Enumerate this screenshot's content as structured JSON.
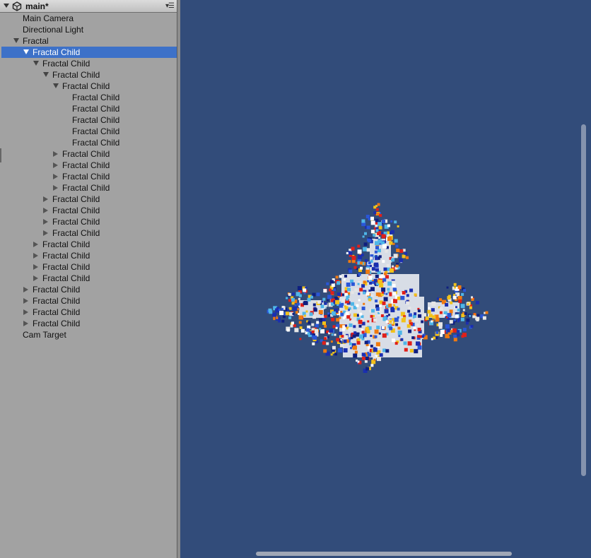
{
  "hierarchy": {
    "scene_name": "main*",
    "items": [
      {
        "label": "Main Camera",
        "depth": 0,
        "arrow": "none",
        "selected": false
      },
      {
        "label": "Directional Light",
        "depth": 0,
        "arrow": "none",
        "selected": false
      },
      {
        "label": "Fractal",
        "depth": 0,
        "arrow": "down",
        "selected": false
      },
      {
        "label": "Fractal Child",
        "depth": 1,
        "arrow": "down",
        "selected": true
      },
      {
        "label": "Fractal Child",
        "depth": 2,
        "arrow": "down",
        "selected": false
      },
      {
        "label": "Fractal Child",
        "depth": 3,
        "arrow": "down",
        "selected": false
      },
      {
        "label": "Fractal Child",
        "depth": 4,
        "arrow": "down",
        "selected": false
      },
      {
        "label": "Fractal Child",
        "depth": 5,
        "arrow": "none",
        "selected": false
      },
      {
        "label": "Fractal Child",
        "depth": 5,
        "arrow": "none",
        "selected": false
      },
      {
        "label": "Fractal Child",
        "depth": 5,
        "arrow": "none",
        "selected": false
      },
      {
        "label": "Fractal Child",
        "depth": 5,
        "arrow": "none",
        "selected": false
      },
      {
        "label": "Fractal Child",
        "depth": 5,
        "arrow": "none",
        "selected": false
      },
      {
        "label": "Fractal Child",
        "depth": 4,
        "arrow": "right",
        "selected": false
      },
      {
        "label": "Fractal Child",
        "depth": 4,
        "arrow": "right",
        "selected": false
      },
      {
        "label": "Fractal Child",
        "depth": 4,
        "arrow": "right",
        "selected": false
      },
      {
        "label": "Fractal Child",
        "depth": 4,
        "arrow": "right",
        "selected": false
      },
      {
        "label": "Fractal Child",
        "depth": 3,
        "arrow": "right",
        "selected": false
      },
      {
        "label": "Fractal Child",
        "depth": 3,
        "arrow": "right",
        "selected": false
      },
      {
        "label": "Fractal Child",
        "depth": 3,
        "arrow": "right",
        "selected": false
      },
      {
        "label": "Fractal Child",
        "depth": 3,
        "arrow": "right",
        "selected": false
      },
      {
        "label": "Fractal Child",
        "depth": 2,
        "arrow": "right",
        "selected": false
      },
      {
        "label": "Fractal Child",
        "depth": 2,
        "arrow": "right",
        "selected": false
      },
      {
        "label": "Fractal Child",
        "depth": 2,
        "arrow": "right",
        "selected": false
      },
      {
        "label": "Fractal Child",
        "depth": 2,
        "arrow": "right",
        "selected": false
      },
      {
        "label": "Fractal Child",
        "depth": 1,
        "arrow": "right",
        "selected": false
      },
      {
        "label": "Fractal Child",
        "depth": 1,
        "arrow": "right",
        "selected": false
      },
      {
        "label": "Fractal Child",
        "depth": 1,
        "arrow": "right",
        "selected": false
      },
      {
        "label": "Fractal Child",
        "depth": 1,
        "arrow": "right",
        "selected": false
      },
      {
        "label": "Cam Target",
        "depth": 0,
        "arrow": "none",
        "selected": false
      }
    ]
  },
  "icons": {
    "collapse": "triangle-down-icon",
    "unity_logo": "unity-logo-icon",
    "panel_menu": "panel-menu-icon"
  },
  "colors": {
    "scene_background": "#324c7a",
    "selection": "#3d71c8",
    "panel_background": "#a2a2a2"
  }
}
